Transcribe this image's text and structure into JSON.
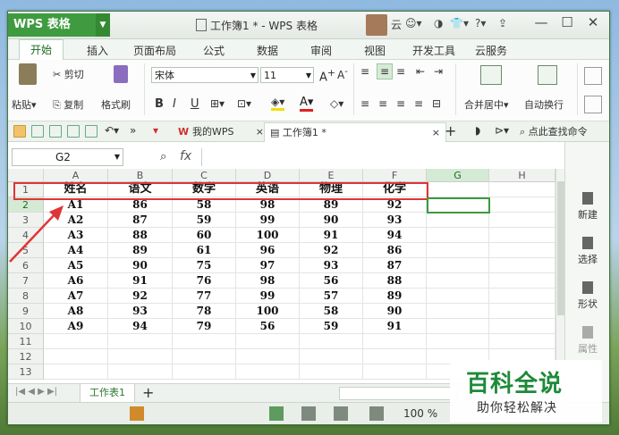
{
  "app": {
    "name": "WPS 表格",
    "doc_title": "工作簿1 * - WPS 表格",
    "user_label": "云",
    "help": "?"
  },
  "menubar": [
    "开始",
    "插入",
    "页面布局",
    "公式",
    "数据",
    "审阅",
    "视图",
    "开发工具",
    "云服务"
  ],
  "ribbon": {
    "paste": "粘贴",
    "cut": "剪切",
    "copy": "复制",
    "format_painter": "格式刷",
    "font_name": "宋体",
    "font_size": "11",
    "bold": "B",
    "italic": "I",
    "underline": "U",
    "merge_center": "合并居中",
    "wrap_text": "自动换行"
  },
  "quickbar": {
    "tab_mywps": "我的WPS",
    "tab_workbook": "工作簿1 *",
    "search": "点此查找命令"
  },
  "formula": {
    "cell_ref": "G2",
    "fx_label": "fx"
  },
  "sheet": {
    "columns": [
      "A",
      "B",
      "C",
      "D",
      "E",
      "F",
      "G",
      "H"
    ],
    "row_numbers": [
      "1",
      "2",
      "3",
      "4",
      "5",
      "6",
      "7",
      "8",
      "9",
      "10",
      "11",
      "12",
      "13"
    ],
    "header_row": [
      "姓名",
      "语文",
      "数学",
      "英语",
      "物理",
      "化学"
    ],
    "rows": [
      [
        "A1",
        "86",
        "58",
        "98",
        "89",
        "92"
      ],
      [
        "A2",
        "87",
        "59",
        "99",
        "90",
        "93"
      ],
      [
        "A3",
        "88",
        "60",
        "100",
        "91",
        "94"
      ],
      [
        "A4",
        "89",
        "61",
        "96",
        "92",
        "86"
      ],
      [
        "A5",
        "90",
        "75",
        "97",
        "93",
        "87"
      ],
      [
        "A6",
        "91",
        "76",
        "98",
        "56",
        "88"
      ],
      [
        "A7",
        "92",
        "77",
        "99",
        "57",
        "89"
      ],
      [
        "A8",
        "93",
        "78",
        "100",
        "58",
        "90"
      ],
      [
        "A9",
        "94",
        "79",
        "56",
        "59",
        "91"
      ]
    ],
    "selected_cell": "G2",
    "sheet_tab": "工作表1"
  },
  "right_panel": [
    "新建",
    "选择",
    "形状",
    "属性"
  ],
  "status": {
    "zoom": "100 %"
  },
  "watermark": {
    "title": "百科全说",
    "subtitle": "助你轻松解决"
  },
  "colors": {
    "accent": "#3f9b3f",
    "highlight_box": "#e03535",
    "selection": "#3c9a3c"
  }
}
